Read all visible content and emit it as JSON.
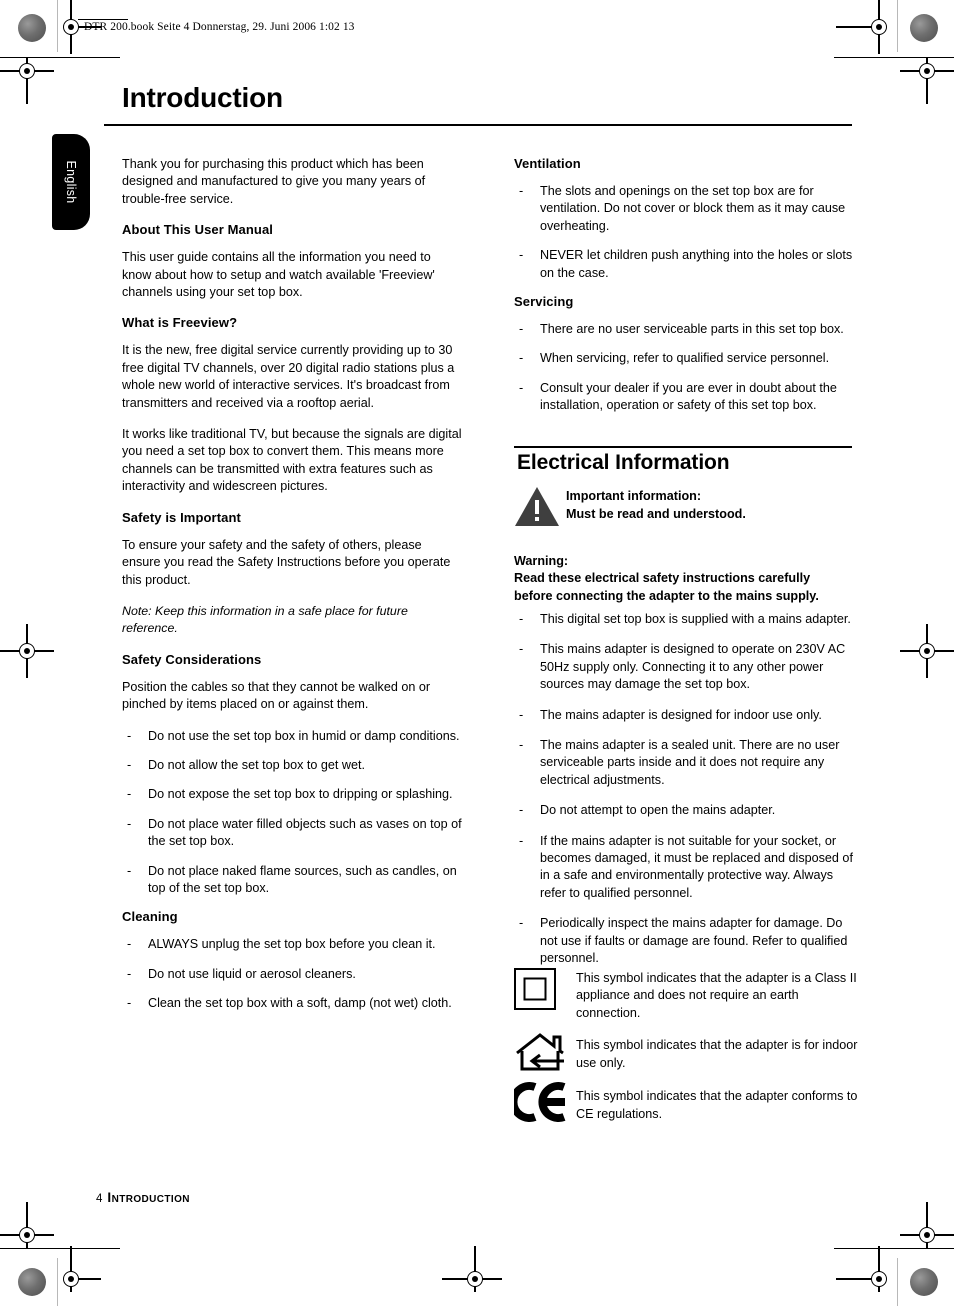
{
  "print_marks": {
    "file_slug": "DTR 200.book  Seite 4  Donnerstag, 29. Juni 2006  1:02 13"
  },
  "language_tab": {
    "label": "English"
  },
  "page": {
    "title": "Introduction",
    "footer_page_number": "4",
    "footer_title": "Introduction"
  },
  "left_column": {
    "intro_paragraph": "Thank you for purchasing this product which has been designed and manufactured to give you many years of trouble-free service.",
    "about_heading": "About This User Manual",
    "about_paragraph": "This user guide contains all the information you need to know about how to setup and watch available 'Freeview' channels using your set top box.",
    "freeview_heading": "What is Freeview?",
    "freeview_paragraph_1": "It is the new, free digital service currently providing up to 30 free digital TV channels, over 20 digital radio stations plus a whole new world of interactive services. It's broadcast from transmitters and received via a rooftop aerial.",
    "freeview_paragraph_2": "It works like traditional TV, but because the signals are digital you need a set top box to convert them. This means more channels can be transmitted with extra features such as interactivity and widescreen pictures.",
    "safety_heading": "Safety is Important",
    "safety_paragraph": "To ensure your safety and the safety of others, please ensure you read the Safety Instructions before you operate this product.",
    "safety_note": "Note: Keep this information in a safe place for future reference.",
    "considerations_heading": "Safety Considerations",
    "considerations_paragraph": "Position the cables so that they cannot be walked on or pinched by items placed on or against them.",
    "considerations_items": [
      "Do not use the set top box in humid or damp conditions.",
      "Do not allow the set top box to get wet.",
      "Do not expose the set top box to dripping or splashing.",
      "Do not place water filled objects such as vases on top of the set top box.",
      "Do not place naked flame sources, such as candles, on top of the set top box."
    ],
    "cleaning_heading": "Cleaning",
    "cleaning_items": [
      "ALWAYS unplug the set top box before you clean it.",
      "Do not use liquid or aerosol cleaners.",
      "Clean the set top box with a soft, damp (not wet) cloth."
    ]
  },
  "right_column": {
    "ventilation_heading": "Ventilation",
    "ventilation_items": [
      "The slots and openings on the set top box are for ventilation. Do not cover or block them as it may cause overheating.",
      "NEVER let children push anything into the holes or slots on the case."
    ],
    "servicing_heading": "Servicing",
    "servicing_items": [
      "There are no user serviceable parts in this set top box.",
      "When servicing, refer to qualified service personnel.",
      "Consult your dealer if you are ever in doubt about the installation, operation or safety of this set top box."
    ]
  },
  "electrical": {
    "section_title": "Electrical Information",
    "important_line_1": "Important information:",
    "important_line_2": "Must be read and understood.",
    "warning_label": "Warning:",
    "warning_line_1": "Read these electrical safety instructions carefully",
    "warning_line_2": "before connecting the adapter to the mains supply.",
    "items": [
      "This digital set top box is supplied with a mains adapter.",
      "This mains adapter is designed to operate on 230V AC 50Hz supply only. Connecting it to any other power sources may damage the set top box.",
      "The mains adapter is designed for indoor use only.",
      "The mains adapter is a sealed unit. There are no user serviceable parts inside and it does not require any electrical adjustments.",
      "Do not attempt to open the mains adapter.",
      "If the mains adapter is not suitable for your socket, or becomes damaged, it must be replaced and disposed of in a safe and environmentally protective way. Always refer to qualified personnel.",
      "Periodically inspect the mains adapter for damage. Do not use if faults or damage are found. Refer to qualified personnel."
    ],
    "symbols": [
      {
        "icon": "class-2-square-icon",
        "text": "This symbol indicates that the adapter is a Class II appliance and does not require an earth connection."
      },
      {
        "icon": "indoor-use-house-icon",
        "text": "This symbol indicates that the adapter is for indoor use only."
      },
      {
        "icon": "ce-mark-icon",
        "text": "This symbol indicates that the adapter conforms to CE regulations."
      }
    ]
  },
  "colors": {
    "page_background": "#ffffff",
    "text": "#000000",
    "tab_background": "#000000",
    "tab_text": "#ffffff",
    "warning_triangle": "#3f3f3f"
  }
}
